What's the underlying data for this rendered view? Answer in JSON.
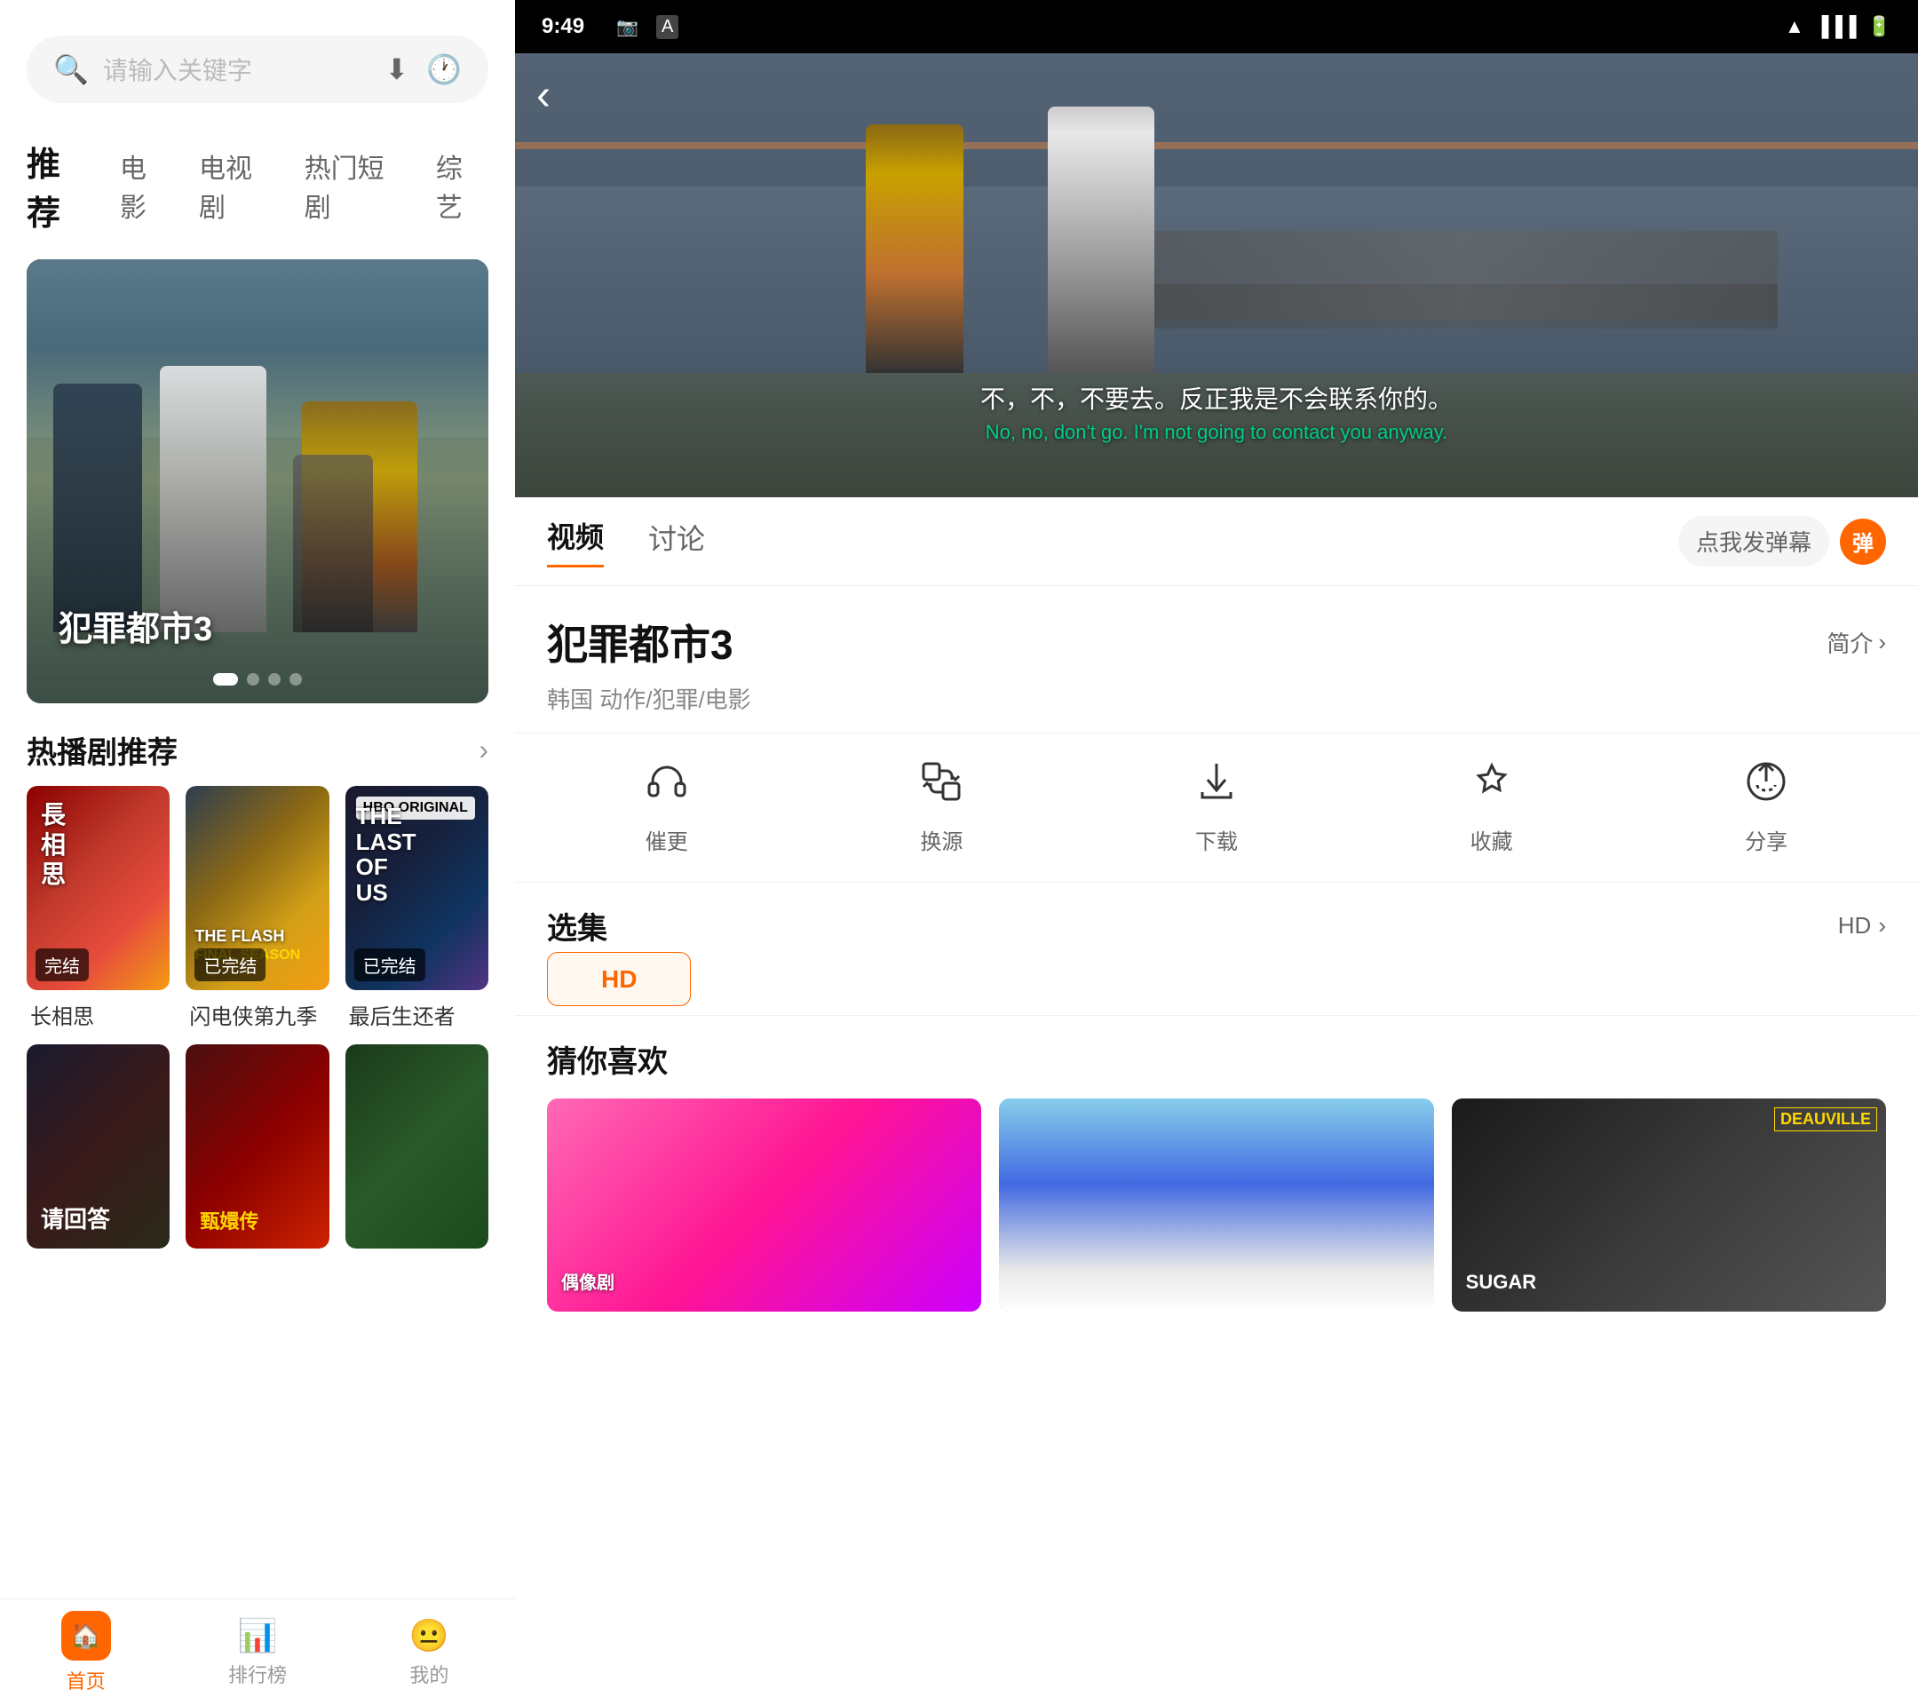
{
  "left": {
    "search": {
      "placeholder": "请输入关键字"
    },
    "nav_tabs": [
      {
        "label": "推荐",
        "active": true
      },
      {
        "label": "电影"
      },
      {
        "label": "电视剧"
      },
      {
        "label": "热门短剧"
      },
      {
        "label": "综艺"
      }
    ],
    "hero": {
      "title": "犯罪都市3"
    },
    "hot_dramas_section": "热播剧推荐",
    "more_icon": "›",
    "dramas": [
      {
        "name": "长相思",
        "badge": "完结",
        "img_class": "card-img-changxiangsi"
      },
      {
        "name": "闪电侠第九季",
        "badge": "已完结",
        "img_class": "card-img-flash"
      },
      {
        "name": "最后生还者",
        "badge": "已完结",
        "img_class": "card-img-lastofus"
      }
    ],
    "bottom_nav": [
      {
        "label": "首页",
        "active": true
      },
      {
        "label": "排行榜",
        "active": false
      },
      {
        "label": "我的",
        "active": false
      }
    ]
  },
  "right": {
    "status_bar": {
      "time": "9:49",
      "icons": [
        "📷",
        "A",
        "▲",
        "🔋"
      ]
    },
    "video": {
      "subtitle_cn": "不，不，不要去。反正我是不会联系你的。",
      "subtitle_en": "No, no, don't go. I'm not going to contact you anyway."
    },
    "tabs": [
      {
        "label": "视频",
        "active": true
      },
      {
        "label": "讨论"
      }
    ],
    "danmaku_label": "点我发弹幕",
    "danmaku_badge": "弹",
    "movie": {
      "title": "犯罪都市3",
      "summary_link": "简介",
      "meta": "韩国 动作/犯罪/电影"
    },
    "actions": [
      {
        "icon": "🎧",
        "label": "催更"
      },
      {
        "icon": "⇄",
        "label": "换源"
      },
      {
        "icon": "⬇",
        "label": "下载"
      },
      {
        "icon": "☆",
        "label": "收藏"
      },
      {
        "icon": "↻",
        "label": "分享"
      }
    ],
    "episodes": {
      "title": "选集",
      "hd_label": "HD",
      "arrow": "›",
      "hd_chip": "HD"
    },
    "recommendations": {
      "title": "猜你喜欢",
      "cards": [
        {
          "img_class": "rec-img-1"
        },
        {
          "img_class": "rec-img-2"
        },
        {
          "img_class": "rec-img-3"
        }
      ]
    }
  }
}
